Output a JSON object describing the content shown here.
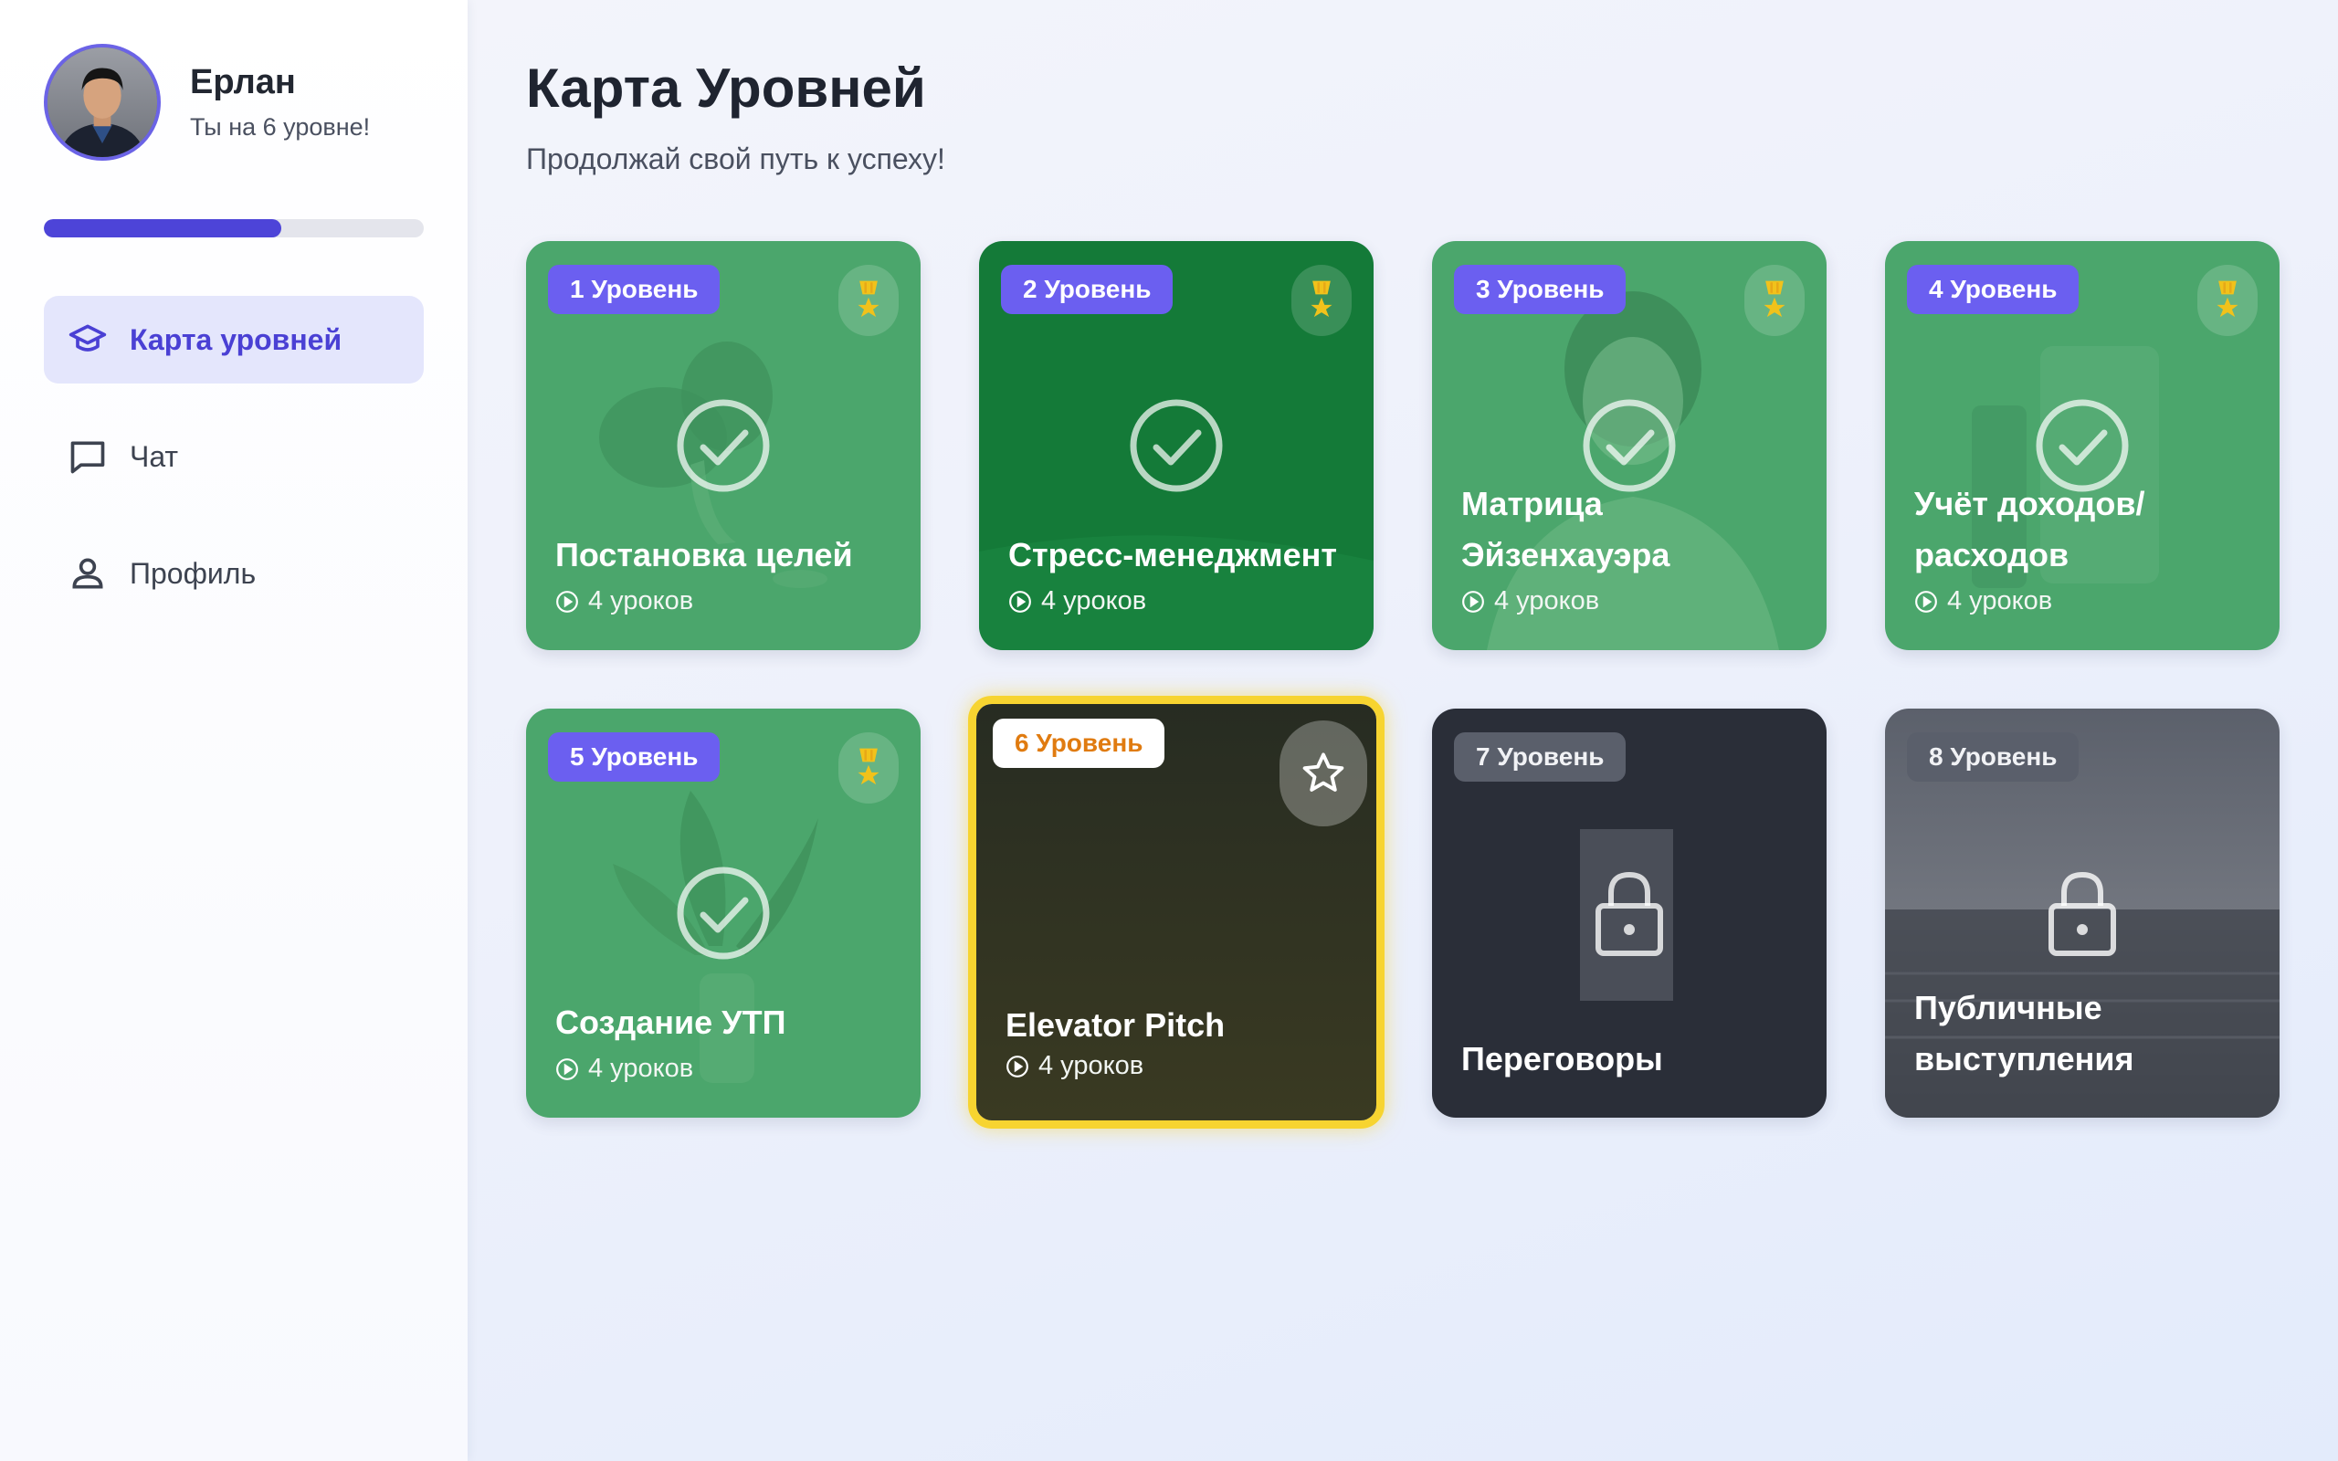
{
  "user": {
    "name": "Ерлан",
    "subtitle": "Ты на 6 уровне!",
    "progress_fraction": 0.625
  },
  "nav": {
    "items": [
      {
        "label": "Карта уровней",
        "icon": "graduation-cap-icon",
        "active": true
      },
      {
        "label": "Чат",
        "icon": "chat-bubble-icon",
        "active": false
      },
      {
        "label": "Профиль",
        "icon": "person-icon",
        "active": false
      }
    ]
  },
  "page": {
    "title": "Карта Уровней",
    "subtitle": "Продолжай свой путь к успеху!"
  },
  "colors": {
    "accent": "#4d44d8",
    "completed_card": "#4ba66c",
    "completed_card_dark": "#147a38",
    "current_border": "#f7d430",
    "locked_card": "#2a2e38",
    "medal": "#f1c21b"
  },
  "levels": [
    {
      "badge": "1 Уровень",
      "title": "Постановка целей",
      "lessons": "4 уроков",
      "status": "completed"
    },
    {
      "badge": "2 Уровень",
      "title": "Стресс-менеджмент",
      "lessons": "4 уроков",
      "status": "completed"
    },
    {
      "badge": "3 Уровень",
      "title": "Матрица Эйзенхауэра",
      "lessons": "4 уроков",
      "status": "completed"
    },
    {
      "badge": "4 Уровень",
      "title": "Учёт доходов/ расходов",
      "lessons": "4 уроков",
      "status": "completed"
    },
    {
      "badge": "5 Уровень",
      "title": "Создание УТП",
      "lessons": "4 уроков",
      "status": "completed"
    },
    {
      "badge": "6 Уровень",
      "title": "Elevator Pitch",
      "lessons": "4 уроков",
      "status": "current"
    },
    {
      "badge": "7 Уровень",
      "title": "Переговоры",
      "lessons": "",
      "status": "locked"
    },
    {
      "badge": "8 Уровень",
      "title": "Публичные выступления",
      "lessons": "",
      "status": "locked"
    }
  ]
}
